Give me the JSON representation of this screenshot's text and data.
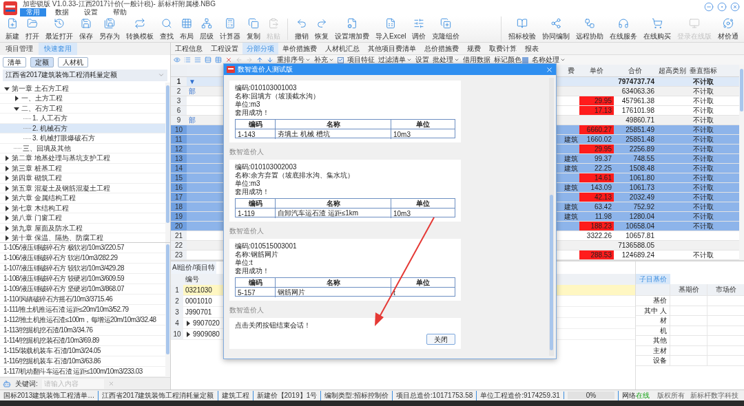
{
  "window": {
    "title": "加密锁版 V1.0.33-江西2017计价(一般计税)- 新标杆附属楼.NBG"
  },
  "menu": [
    {
      "label": "常用",
      "selected": true
    },
    {
      "label": "数据",
      "selected": false
    },
    {
      "label": "设置",
      "selected": false
    },
    {
      "label": "帮助",
      "selected": false
    }
  ],
  "toolbar": {
    "groups": [
      [
        {
          "label": "新建",
          "disabled": false
        },
        {
          "label": "打开",
          "disabled": false
        },
        {
          "label": "最近打开",
          "disabled": false
        },
        {
          "label": "保存",
          "disabled": false
        },
        {
          "label": "另存为",
          "disabled": false
        },
        {
          "label": "转换模板",
          "disabled": false
        },
        {
          "label": "查找",
          "disabled": false
        },
        {
          "label": "布局",
          "disabled": false
        },
        {
          "label": "层级",
          "disabled": false
        },
        {
          "label": "计算器",
          "disabled": false
        },
        {
          "label": "复制",
          "disabled": false
        },
        {
          "label": "粘贴",
          "disabled": true
        }
      ],
      [
        {
          "label": "撤销",
          "disabled": false
        },
        {
          "label": "恢复",
          "disabled": false
        },
        {
          "label": "设置增加费",
          "disabled": false
        },
        {
          "label": "导入Excel",
          "disabled": false
        },
        {
          "label": "调价",
          "disabled": false
        },
        {
          "label": "克隆组价",
          "disabled": false
        }
      ]
    ],
    "right": [
      {
        "label": "招标校验",
        "disabled": false
      },
      {
        "label": "协同编制",
        "disabled": false
      },
      {
        "label": "远程协助",
        "disabled": false
      },
      {
        "label": "在线服务",
        "disabled": false
      },
      {
        "label": "在线购买",
        "disabled": false
      },
      {
        "label": "登录在线版",
        "disabled": true
      },
      {
        "label": "材价通",
        "disabled": false
      }
    ]
  },
  "left_panel": {
    "tabs": [
      {
        "label": "项目管理",
        "selected": false
      },
      {
        "label": "快速套用",
        "selected": true
      }
    ],
    "filters": [
      {
        "label": "清单",
        "selected": false
      },
      {
        "label": "定额",
        "selected": true
      },
      {
        "label": "人材机",
        "selected": false
      }
    ],
    "library": "江西省2017建筑装饰工程消耗量定额",
    "tree": [
      {
        "label": "第一章 土石方工程",
        "expanded": true,
        "selected": false,
        "children": [
          {
            "label": "一、土方工程",
            "expanded": false,
            "selected": false
          },
          {
            "label": "二、石方工程",
            "expanded": true,
            "selected": false,
            "children": [
              {
                "label": "1. 人工石方",
                "selected": false
              },
              {
                "label": "2. 机械石方",
                "selected": true
              },
              {
                "label": "3. 机械打眼爆破石方",
                "selected": false
              }
            ]
          },
          {
            "label": "三、回填及其他",
            "selected": false
          }
        ]
      },
      {
        "label": "第二章 地基处理与基坑支护工程",
        "expanded": false,
        "selected": false
      },
      {
        "label": "第三章 桩基工程",
        "expanded": false,
        "selected": false
      },
      {
        "label": "第四章 砌筑工程",
        "expanded": false,
        "selected": false
      },
      {
        "label": "第五章 混凝土及钢筋混凝土工程",
        "expanded": false,
        "selected": false
      },
      {
        "label": "第六章 金属结构工程",
        "expanded": false,
        "selected": false
      },
      {
        "label": "第七章 木结构工程",
        "expanded": false,
        "selected": false
      },
      {
        "label": "第八章 门窗工程",
        "expanded": false,
        "selected": false
      },
      {
        "label": "第九章 屋面及防水工程",
        "expanded": false,
        "selected": false
      },
      {
        "label": "第十章 保温、隔热、防腐工程",
        "expanded": false,
        "selected": false
      }
    ],
    "items": [
      "1-105/液压锤破碎石方 极软岩/10m3/220.57",
      "1-106/液压锤破碎石方 软岩/10m3/282.29",
      "1-107/液压锤破碎石方 较软岩/10m3/429.28",
      "1-108/液压锤破碎石方 较硬岩/10m3/609.59",
      "1-109/液压锤破碎石方 坚硬岩/10m3/868.07",
      "1-110/风镐破碎石方摇石/10m3/3715.46",
      "1-111/推土机推运石渣 运距≤20m/10m3/52.79",
      "1-112/推土机推运石渣≤100m，每增运20m/10m3/32.48",
      "1-113/挖掘机挖石渣/10m3/34.76",
      "1-114/挖掘机挖装石渣/10m3/69.89",
      "1-115/装载机装车 石渣/10m3/24.05",
      "1-116/挖掘机装车 石渣/10m3/63.86",
      "1-117/机动翻斗车运石渣 运距≤100m/10m3/233.03"
    ],
    "keyword": {
      "label": "关键词:",
      "placeholder": "请输入内容"
    }
  },
  "main": {
    "tabs": [
      {
        "label": "工程信息",
        "selected": false
      },
      {
        "label": "工程设置",
        "selected": false
      },
      {
        "label": "分部分项",
        "selected": true
      },
      {
        "label": "单价措施费",
        "selected": false
      },
      {
        "label": "人材机汇总",
        "selected": false
      },
      {
        "label": "其他项目费清单",
        "selected": false
      },
      {
        "label": "总价措施费",
        "selected": false
      },
      {
        "label": "规费",
        "selected": false
      },
      {
        "label": "取费计算",
        "selected": false
      },
      {
        "label": "报表",
        "selected": false
      }
    ],
    "icon_buttons": [
      {
        "disabled": false
      },
      {
        "disabled": false
      },
      {
        "disabled": false
      },
      {
        "disabled": false
      },
      {
        "disabled": false
      },
      {
        "disabled": false
      },
      {
        "disabled": true
      },
      {
        "disabled": true
      },
      {
        "disabled": false
      },
      {
        "disabled": false
      }
    ],
    "tools": [
      {
        "label": "重排序号",
        "kind": "dropdown"
      },
      {
        "label": "补充",
        "kind": "dropdown"
      },
      {
        "label": "项目特征",
        "kind": "checkbox",
        "checked": true
      },
      {
        "label": "过滤清单",
        "kind": "dropdown"
      },
      {
        "label": "设置",
        "kind": "button"
      },
      {
        "label": "批处理",
        "kind": "dropdown"
      },
      {
        "label": "借用数据",
        "kind": "button"
      },
      {
        "label": "标记颜色",
        "kind": "color"
      },
      {
        "label": "名称处理",
        "kind": "dropdown"
      }
    ],
    "grid": {
      "columns": [
        "费",
        "单价",
        "合价",
        "超高类别",
        "垂直指标"
      ],
      "rows": [
        {
          "num": "1",
          "marker": "▼",
          "kind": "total",
          "selected": false,
          "flagged": false,
          "total": "7974737.74",
          "vertical": "不计取"
        },
        {
          "num": "2",
          "marker": "部",
          "kind": "section",
          "selected": false,
          "flagged": false,
          "total": "634063.36",
          "vertical": "不计取"
        },
        {
          "num": "3",
          "kind": "item",
          "selected": false,
          "flagged": true,
          "price": "29.95",
          "total": "457961.38",
          "vertical": "不计取"
        },
        {
          "num": "6",
          "kind": "item",
          "selected": false,
          "flagged": true,
          "price": "17.13",
          "total": "176101.98",
          "vertical": "不计取"
        },
        {
          "num": "9",
          "marker": "部",
          "kind": "section",
          "selected": false,
          "flagged": false,
          "total": "49860.71",
          "vertical": "不计取"
        },
        {
          "num": "10",
          "kind": "item",
          "selected": true,
          "flagged": true,
          "price": "6660.27",
          "total": "25851.49",
          "vertical": "不计取"
        },
        {
          "num": "11",
          "kind": "item",
          "selected": true,
          "flagged": false,
          "column_1": "建筑",
          "price": "1660.02",
          "total": "25851.48",
          "vertical": "不计取"
        },
        {
          "num": "12",
          "kind": "item",
          "selected": true,
          "flagged": true,
          "price": "29.95",
          "total": "2256.89",
          "vertical": "不计取"
        },
        {
          "num": "13",
          "kind": "item",
          "selected": true,
          "flagged": false,
          "column_1": "建筑",
          "price": "99.37",
          "total": "748.55",
          "vertical": "不计取"
        },
        {
          "num": "14",
          "kind": "item",
          "selected": true,
          "flagged": false,
          "column_1": "建筑",
          "price": "22.25",
          "total": "1508.48",
          "vertical": "不计取"
        },
        {
          "num": "15",
          "kind": "item",
          "selected": true,
          "flagged": true,
          "price": "14.61",
          "total": "1061.80",
          "vertical": "不计取"
        },
        {
          "num": "16",
          "kind": "item",
          "selected": true,
          "flagged": false,
          "column_1": "建筑",
          "price": "143.09",
          "total": "1061.73",
          "vertical": "不计取"
        },
        {
          "num": "17",
          "kind": "item",
          "selected": true,
          "flagged": true,
          "price": "42.13",
          "total": "2032.49",
          "vertical": "不计取"
        },
        {
          "num": "18",
          "kind": "item",
          "selected": true,
          "flagged": false,
          "column_1": "建筑",
          "price": "63.42",
          "total": "752.92",
          "vertical": "不计取"
        },
        {
          "num": "19",
          "kind": "item",
          "selected": true,
          "flagged": false,
          "column_1": "建筑",
          "price": "11.98",
          "total": "1280.04",
          "vertical": "不计取"
        },
        {
          "num": "20",
          "kind": "item",
          "selected": true,
          "flagged": true,
          "price": "188.23",
          "total": "10658.04",
          "vertical": "不计取"
        },
        {
          "num": "21",
          "kind": "item",
          "selected": false,
          "flagged": false,
          "price": "3322.26",
          "total": "10657.81"
        },
        {
          "num": "22",
          "kind": "section",
          "selected": false,
          "flagged": false,
          "total": "7136588.05"
        },
        {
          "num": "23",
          "kind": "item",
          "selected": false,
          "flagged": true,
          "price": "288.53",
          "total": "124689.24",
          "vertical": "不计取"
        }
      ]
    },
    "lower_panel": {
      "tab": "AI组价/项目特",
      "header": "编号",
      "rows": [
        {
          "num": "1",
          "code": "0321030",
          "selected": true
        },
        {
          "num": "2",
          "code": "0001010",
          "selected": false
        },
        {
          "num": "3",
          "code": "J990701",
          "selected": false
        },
        {
          "num": "4",
          "code": "9907020",
          "selected": false,
          "expanded": false
        },
        {
          "num": "10",
          "code": "9909080",
          "selected": false,
          "expanded": false
        }
      ]
    },
    "price_panel": {
      "tab": "子目基价",
      "columns": [
        "基期价",
        "市场价"
      ],
      "rows": [
        "基价",
        "其中 人",
        "材",
        "机",
        "其他",
        "主材",
        "设备"
      ]
    }
  },
  "dialog": {
    "title": "数智造价人测试版",
    "messages": [
      {
        "kind": "result",
        "lines": [
          "编码:010103001003",
          "名称:回填方（坡顶截水沟）",
          "单位:m3",
          "套用成功！"
        ],
        "table": {
          "columns": [
            "编码",
            "名称",
            "单位"
          ],
          "rows": [
            [
              "1-143",
              "夯填土 机械 槽坑",
              "10m3"
            ]
          ]
        }
      },
      {
        "kind": "result",
        "sender": "数智造价人",
        "lines": [
          "编码:010103002003",
          "名称:余方弃置（坡底排水沟、集水坑）",
          "单位:m3",
          "套用成功！"
        ],
        "table": {
          "columns": [
            "编码",
            "名称",
            "单位"
          ],
          "rows": [
            [
              "1-119",
              "自卸汽车运石渣 运距≤1km",
              "10m3"
            ]
          ]
        }
      },
      {
        "kind": "result",
        "sender": "数智造价人",
        "lines": [
          "编码:010515003001",
          "名称:钢筋网片",
          "单位:t",
          "套用成功！"
        ],
        "table": {
          "columns": [
            "编码",
            "名称",
            "单位"
          ],
          "rows": [
            [
              "5-157",
              "钢筋网片",
              "t"
            ]
          ]
        }
      },
      {
        "kind": "closing",
        "sender": "数智造价人",
        "text": "点击关闭按钮结束会话！",
        "button": "关闭"
      }
    ]
  },
  "status_bar": {
    "items": [
      {
        "kind": "text",
        "text": "国标2013建筑装饰工程清单…"
      },
      {
        "kind": "text",
        "text": "江西省2017建筑装饰工程消耗量定额"
      },
      {
        "kind": "text",
        "text": "建筑工程"
      },
      {
        "kind": "text",
        "text": "新建价【2019】1号"
      },
      {
        "kind": "text",
        "text": "编制类型:招标控制价"
      },
      {
        "kind": "text",
        "text": "项目总造价:10171753.58"
      },
      {
        "kind": "text",
        "text": "单位工程造价:9174259.31"
      },
      {
        "kind": "progress",
        "label": "0%",
        "level": 0
      },
      {
        "kind": "network",
        "label": "网络",
        "value": "在线"
      }
    ],
    "right": [
      "版权所有",
      "新标杆数字科技"
    ]
  }
}
